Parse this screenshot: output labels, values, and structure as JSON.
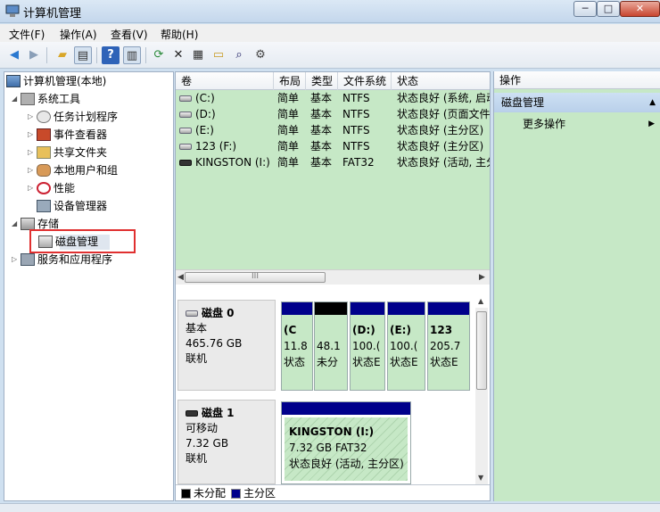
{
  "window": {
    "title": "计算机管理",
    "controls": {
      "minimize": "─",
      "maximize": "□",
      "close": "✕"
    }
  },
  "menu": [
    "文件(F)",
    "操作(A)",
    "查看(V)",
    "帮助(H)"
  ],
  "toolbar": [
    "back-icon",
    "forward-icon",
    "up-folder-icon",
    "show-tree-icon",
    "help-icon",
    "show-action-pane-icon",
    "refresh-icon",
    "delete-icon",
    "properties-icon",
    "open-icon",
    "search-icon",
    "settings-icon"
  ],
  "tree": {
    "root": "计算机管理(本地)",
    "system_tools": "系统工具",
    "task_scheduler": "任务计划程序",
    "event_viewer": "事件查看器",
    "shared_folders": "共享文件夹",
    "local_users": "本地用户和组",
    "performance": "性能",
    "device_manager": "设备管理器",
    "storage": "存储",
    "disk_management": "磁盘管理",
    "services": "服务和应用程序"
  },
  "volumes": {
    "headers": [
      "卷",
      "布局",
      "类型",
      "文件系统",
      "状态"
    ],
    "rows": [
      {
        "name": "(C:)",
        "layout": "简单",
        "type": "基本",
        "fs": "NTFS",
        "status": "状态良好 (系统, 启动"
      },
      {
        "name": "(D:)",
        "layout": "简单",
        "type": "基本",
        "fs": "NTFS",
        "status": "状态良好 (页面文件"
      },
      {
        "name": "(E:)",
        "layout": "简单",
        "type": "基本",
        "fs": "NTFS",
        "status": "状态良好 (主分区)"
      },
      {
        "name": "123 (F:)",
        "layout": "简单",
        "type": "基本",
        "fs": "NTFS",
        "status": "状态良好 (主分区)"
      },
      {
        "name": "KINGSTON (I:)",
        "layout": "简单",
        "type": "基本",
        "fs": "FAT32",
        "status": "状态良好 (活动, 主分"
      }
    ],
    "hscroll_grip": "III"
  },
  "disks": [
    {
      "name": "磁盘 0",
      "kind": "基本",
      "size": "465.76 GB",
      "state": "联机",
      "partitions": [
        {
          "label": "(C",
          "size": "11.8",
          "status": "状态"
        },
        {
          "label": "",
          "size": "48.1",
          "status": "未分"
        },
        {
          "label": "(D:)",
          "size": "100.(",
          "status": "状态E"
        },
        {
          "label": "(E:)",
          "size": "100.(",
          "status": "状态E"
        },
        {
          "label": "123",
          "size": "205.7",
          "status": "状态E"
        }
      ]
    },
    {
      "name": "磁盘 1",
      "kind": "可移动",
      "size": "7.32 GB",
      "state": "联机",
      "partitions": [
        {
          "label": "KINGSTON  (I:)",
          "size": "7.32 GB FAT32",
          "status": "状态良好 (活动, 主分区)"
        }
      ]
    }
  ],
  "legend": {
    "unallocated": "未分配",
    "primary": "主分区"
  },
  "actions": {
    "header": "操作",
    "section": "磁盘管理",
    "more": "更多操作"
  },
  "colors": {
    "highlight_box": "#e03030",
    "primary_partition": "#00008b",
    "volume_bg": "#c6e8c6"
  }
}
